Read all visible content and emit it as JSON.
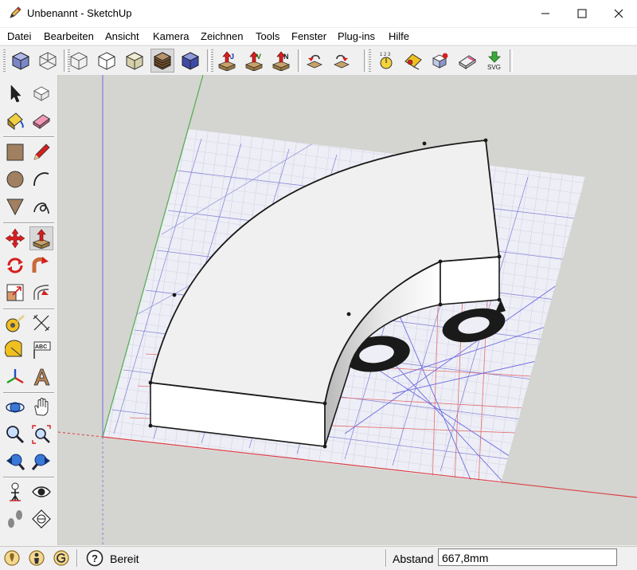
{
  "window": {
    "title": "Unbenannt - SketchUp",
    "app_icon": "sketchup-pencil-icon",
    "controls": [
      "minimize-icon",
      "maximize-icon",
      "close-icon"
    ]
  },
  "menu": {
    "items": [
      {
        "label": "Datei"
      },
      {
        "label": "Bearbeiten"
      },
      {
        "label": "Ansicht"
      },
      {
        "label": "Kamera"
      },
      {
        "label": "Zeichnen"
      },
      {
        "label": "Tools"
      },
      {
        "label": "Fenster"
      },
      {
        "label": "Plug-ins"
      },
      {
        "label": "Hilfe"
      }
    ]
  },
  "toolbar_top": {
    "groups": [
      [
        "iso-view-icon",
        "wireframe-icon"
      ],
      [
        "xray-icon",
        "hidden-line-icon",
        "shaded-icon",
        "shaded-textures-icon",
        "monochrome-icon"
      ],
      [
        "join-push-pull-icon",
        "vector-push-pull-icon",
        "normal-push-pull-icon"
      ],
      [
        "undo-push-pull-icon",
        "repeat-push-pull-icon"
      ],
      [
        "measure-cad-icon",
        "dimension-tool-icon",
        "component-tool-icon",
        "eraser-tool-icon",
        "export-svg-icon"
      ]
    ],
    "svg_button_label": "SVG"
  },
  "toolbar_left": {
    "tools": [
      "select-icon",
      "make-component-icon",
      "paint-bucket-icon",
      "eraser-icon",
      "rectangle-icon",
      "line-icon",
      "circle-icon",
      "arc-icon",
      "polygon-icon",
      "freehand-icon",
      "move-icon",
      "push-pull-icon",
      "rotate-icon",
      "follow-me-icon",
      "scale-icon",
      "offset-icon",
      "tape-measure-icon",
      "dimension-icon",
      "protractor-icon",
      "text-icon",
      "axes-icon",
      "3d-text-icon",
      "orbit-icon",
      "pan-icon",
      "zoom-icon",
      "zoom-extents-icon",
      "previous-view-icon",
      "next-view-icon",
      "position-camera-icon",
      "look-around-icon",
      "walk-icon",
      "section-plane-icon"
    ],
    "text_tool_label": "ABC"
  },
  "status": {
    "icons": [
      "geo-location-icon",
      "credits-icon",
      "signin-icon"
    ],
    "help_icon": "help-icon",
    "text": "Bereit",
    "measure_label": "Abstand",
    "measure_value": "667,8mm"
  },
  "viewport": {
    "background": "#d4d4d0",
    "axis_colors": {
      "red": "#d94040",
      "green": "#4cae4c",
      "blue": "#6f6fd8"
    },
    "face_color": "#f0f0f0",
    "edge_color": "#1a1a1a",
    "image_overlay": "grid paper with shape"
  }
}
